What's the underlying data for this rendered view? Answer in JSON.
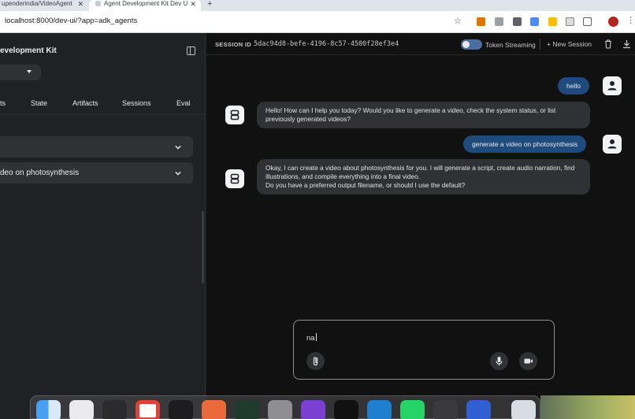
{
  "browser": {
    "tabs": [
      {
        "label": "upenderindia/VideoAgent"
      },
      {
        "label": "Agent Development Kit Dev U"
      }
    ],
    "url": "localhost:8000/dev-ui/?app=adk_agents"
  },
  "sidebar": {
    "title": "evelopment Kit",
    "tabs": [
      "ts",
      "State",
      "Artifacts",
      "Sessions",
      "Eval"
    ],
    "cards": [
      {
        "label": ""
      },
      {
        "label": "deo on photosynthesis"
      }
    ]
  },
  "topbar": {
    "session_label": "SESSION ID",
    "session_id": "5dac94d8-befe-4196-8c57-4500f28ef3e4",
    "token_streaming_label": "Token Streaming",
    "new_session_label": "+ New Session"
  },
  "messages": [
    {
      "role": "user",
      "text": "hello"
    },
    {
      "role": "bot",
      "lines": [
        "Hello! How can I help you today? Would you like to generate a video, check the system status, or list previously generated videos?"
      ]
    },
    {
      "role": "user",
      "text": "generate a video on photosynthesis"
    },
    {
      "role": "bot",
      "lines": [
        "Okay, I can create a video about photosynthesis for you. I will generate a script, create audio narration, find illustrations, and compile everything into a final video.",
        "Do you have a preferred output filename, or should I use the default?"
      ]
    }
  ],
  "composer": {
    "value": "na"
  },
  "colors": {
    "user_bubble": "#1e4b7c",
    "bot_bubble": "#303134",
    "main_bg": "#111111",
    "sidebar_bg": "#202124"
  },
  "icons": {
    "attach": "paperclip-icon",
    "mic": "microphone-icon",
    "camera": "videocam-icon",
    "trash": "trash-icon",
    "download": "download-icon"
  }
}
